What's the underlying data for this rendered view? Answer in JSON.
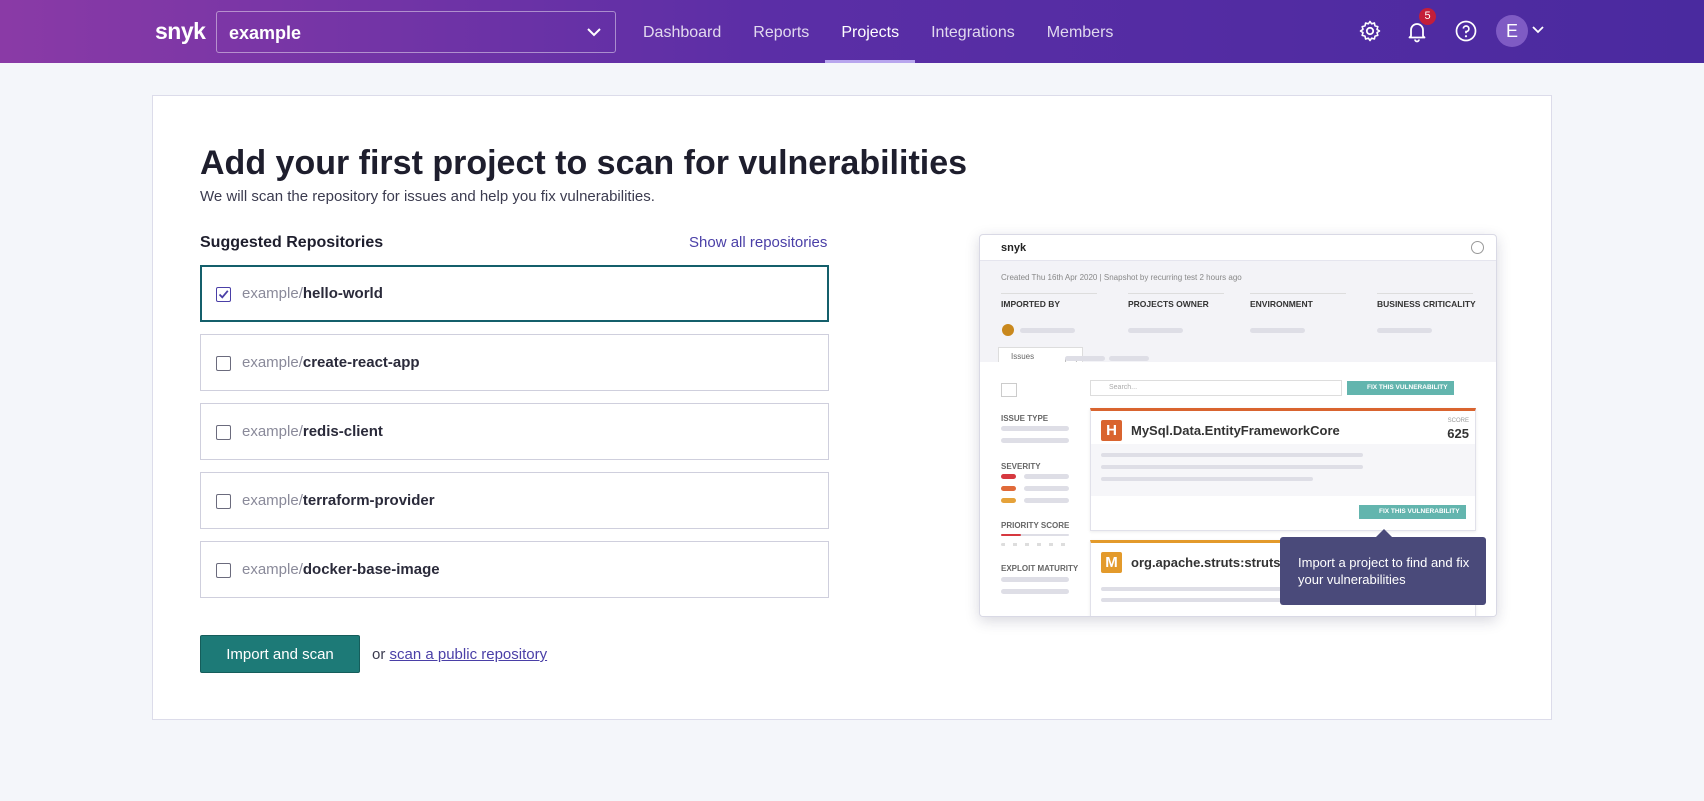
{
  "brand": {
    "logo": "snyk"
  },
  "org_select": {
    "value": "example"
  },
  "nav": {
    "items": [
      {
        "label": "Dashboard"
      },
      {
        "label": "Reports"
      },
      {
        "label": "Projects"
      },
      {
        "label": "Integrations"
      },
      {
        "label": "Members"
      }
    ],
    "active": "Projects"
  },
  "notifications": {
    "count": "5"
  },
  "user": {
    "initial": "E"
  },
  "main": {
    "title": "Add your first project to scan for vulnerabilities",
    "subtitle": "We will scan the repository for issues and help you fix vulnerabilities.",
    "section_label": "Suggested Repositories",
    "show_all_label": "Show all repositories",
    "repos": [
      {
        "org": "example/",
        "name": "hello-world",
        "checked": true
      },
      {
        "org": "example/",
        "name": "create-react-app",
        "checked": false
      },
      {
        "org": "example/",
        "name": "redis-client",
        "checked": false
      },
      {
        "org": "example/",
        "name": "terraform-provider",
        "checked": false
      },
      {
        "org": "example/",
        "name": "docker-base-image",
        "checked": false
      }
    ],
    "import_button": "Import and scan",
    "or_text": "or",
    "public_link": "scan a public repository"
  },
  "preview": {
    "logo": "snyk",
    "created": "Created Thu 16th Apr 2020  |  Snapshot by recurring test 2 hours ago",
    "columns": [
      "IMPORTED BY",
      "PROJECTS OWNER",
      "ENVIRONMENT",
      "BUSINESS CRITICALITY"
    ],
    "tab_label": "Issues",
    "search_placeholder": "Search...",
    "fix_label": "FIX THIS VULNERABILITY",
    "filters": [
      "ISSUE TYPE",
      "SEVERITY",
      "PRIORITY SCORE",
      "EXPLOIT MATURITY"
    ],
    "issues": [
      {
        "severity": "H",
        "name": "MySql.Data.EntityFrameworkCore",
        "score_label": "SCORE",
        "score": "625",
        "color": "#d9642f"
      },
      {
        "severity": "M",
        "name": "org.apache.struts:struts2-",
        "color": "#e39a2b"
      }
    ],
    "tooltip": "Import a project to find and fix your vulnerabilities"
  },
  "colors": {
    "primary_button": "#1d7a77",
    "link": "#4a3fa7",
    "header_start": "#8a3aa6",
    "header_end": "#4a2a9f"
  }
}
